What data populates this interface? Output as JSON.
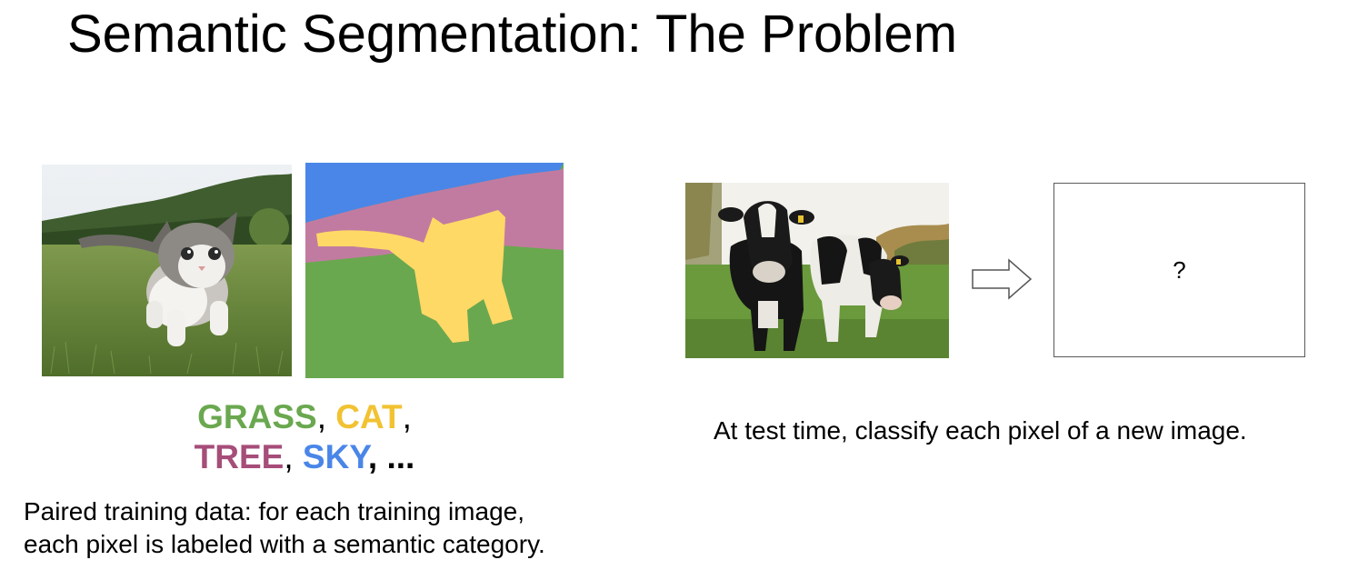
{
  "slide": {
    "title": "Semantic Segmentation: The Problem"
  },
  "left": {
    "labels": {
      "grass": "GRASS",
      "sep1": ",",
      "cat": "CAT",
      "sep2": ",",
      "tree": "TREE",
      "sep3": ",",
      "sky": "SKY",
      "rest": ", ..."
    },
    "caption_line1": "Paired training data: for each training image,",
    "caption_line2": "each pixel is labeled with a semantic category."
  },
  "right": {
    "output_placeholder": "?",
    "caption": "At test time, classify each pixel of a new image."
  },
  "colors": {
    "grass": "#6aa84f",
    "cat": "#f1c232",
    "tree": "#a64d79",
    "sky": "#4a86e8",
    "seg_grass": "#6aa84f",
    "seg_cat": "#ffd966",
    "seg_tree": "#c27ba0",
    "seg_sky": "#4a86e8"
  },
  "icons": {
    "arrow": "right-arrow-outline-icon"
  }
}
